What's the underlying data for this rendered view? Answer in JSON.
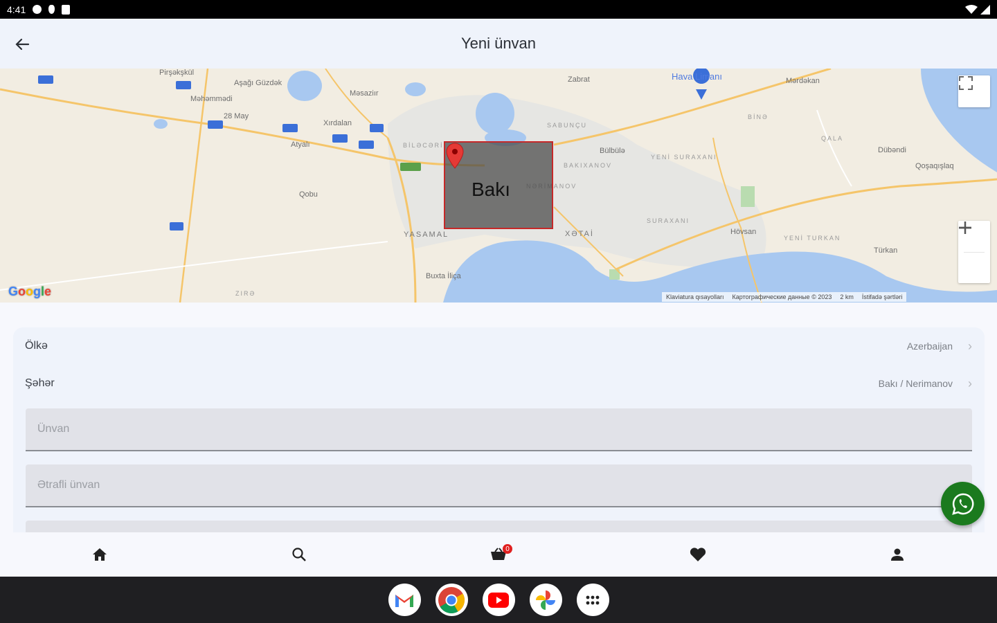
{
  "status_bar": {
    "time": "4:41"
  },
  "appbar": {
    "title": "Yeni ünvan"
  },
  "map": {
    "city_label": "Bakı",
    "labels": [
      "Pirşəkşkül",
      "Aşağı Güzdək",
      "Məhəmmədi",
      "Məsaziır",
      "28 May",
      "Xırdalan",
      "Atyalı",
      "Qobu",
      "Zabrat",
      "Hava Limanı",
      "Mərdəkan",
      "Bülbülə",
      "Dübəndi",
      "Qoşaqışlaq",
      "Hövsan",
      "Türkan",
      "Buxta İliça",
      "XƏTAİ",
      "YASAMAL",
      "SABUNÇU",
      "BAKIXANOV",
      "YENİ SURAXANI",
      "SURAXANI",
      "NƏRİMANOV",
      "BİLƏCƏRİ",
      "QALA",
      "BİNƏ",
      "YENİ TURKAN",
      "ZIRƏ"
    ],
    "attribution": [
      "Klaviatura qısayolları",
      "Картографические данные © 2023",
      "2 km",
      "İstifadə şərtləri"
    ],
    "logo": "Google"
  },
  "form": {
    "country_label": "Ölkə",
    "country_value": "Azerbaijan",
    "city_label": "Şəhər",
    "city_value": "Bakı / Nerimanov",
    "address_placeholder": "Ünvan",
    "nearby_address_placeholder": "Ətrafli ünvan"
  },
  "bottom_nav": {
    "cart_badge": "0"
  },
  "icons": [
    "back-arrow-icon",
    "fullscreen-icon",
    "zoom-in-icon",
    "zoom-out-icon",
    "map-pin-icon",
    "whatsapp-icon",
    "home-icon",
    "search-icon",
    "cart-icon",
    "heart-icon",
    "person-icon",
    "gmail-icon",
    "chrome-icon",
    "youtube-icon",
    "photos-icon",
    "app-drawer-icon"
  ],
  "colors": {
    "accent_green": "#1b7a1e",
    "badge_red": "#e02020",
    "marker_border": "#c62828",
    "appbar_bg": "#eff3fb"
  }
}
